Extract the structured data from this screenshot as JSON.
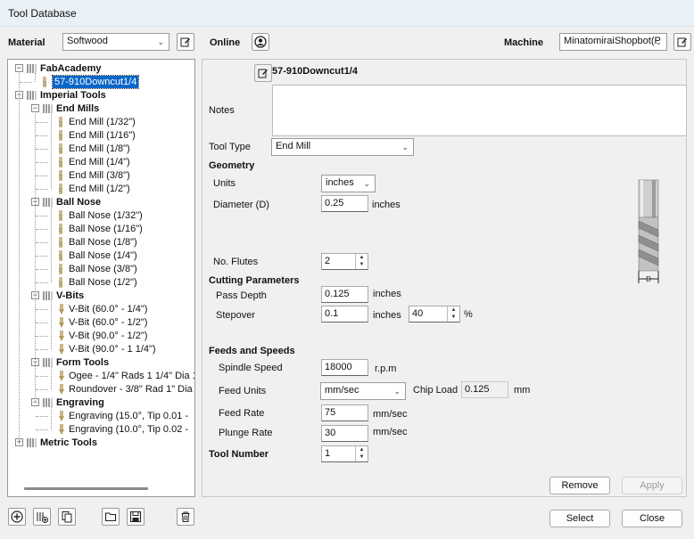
{
  "window": {
    "title": "Tool Database"
  },
  "top": {
    "material_label": "Material",
    "material_value": "Softwood",
    "online_label": "Online",
    "machine_label": "Machine",
    "machine_value": "MinatomiraiShopbot(P"
  },
  "tree": {
    "items": [
      {
        "label": "FabAcademy",
        "bold": true,
        "level": 0,
        "type": "group",
        "expander": "−"
      },
      {
        "label": "57-910Downcut1/4",
        "bold": false,
        "level": 1,
        "type": "tool",
        "selected": true
      },
      {
        "label": "Imperial Tools",
        "bold": true,
        "level": 0,
        "type": "group",
        "expander": "−"
      },
      {
        "label": "End Mills",
        "bold": true,
        "level": 1,
        "type": "group",
        "expander": "−"
      },
      {
        "label": "End Mill (1/32\")",
        "level": 2,
        "type": "tool"
      },
      {
        "label": "End Mill (1/16\")",
        "level": 2,
        "type": "tool"
      },
      {
        "label": "End Mill (1/8\")",
        "level": 2,
        "type": "tool"
      },
      {
        "label": "End Mill (1/4\")",
        "level": 2,
        "type": "tool"
      },
      {
        "label": "End Mill (3/8\")",
        "level": 2,
        "type": "tool"
      },
      {
        "label": "End Mill (1/2\")",
        "level": 2,
        "type": "tool"
      },
      {
        "label": "Ball Nose",
        "bold": true,
        "level": 1,
        "type": "group",
        "expander": "−"
      },
      {
        "label": "Ball Nose (1/32\")",
        "level": 2,
        "type": "tool"
      },
      {
        "label": "Ball Nose (1/16\")",
        "level": 2,
        "type": "tool"
      },
      {
        "label": "Ball Nose (1/8\")",
        "level": 2,
        "type": "tool"
      },
      {
        "label": "Ball Nose (1/4\")",
        "level": 2,
        "type": "tool"
      },
      {
        "label": "Ball Nose (3/8\")",
        "level": 2,
        "type": "tool"
      },
      {
        "label": "Ball Nose (1/2\")",
        "level": 2,
        "type": "tool"
      },
      {
        "label": "V-Bits",
        "bold": true,
        "level": 1,
        "type": "group",
        "expander": "−"
      },
      {
        "label": "V-Bit (60.0° - 1/4\")",
        "level": 2,
        "type": "vbit"
      },
      {
        "label": "V-Bit (60.0° - 1/2\")",
        "level": 2,
        "type": "vbit"
      },
      {
        "label": "V-Bit (90.0° - 1/2\")",
        "level": 2,
        "type": "vbit"
      },
      {
        "label": "V-Bit (90.0° - 1 1/4\")",
        "level": 2,
        "type": "vbit"
      },
      {
        "label": "Form Tools",
        "bold": true,
        "level": 1,
        "type": "group",
        "expander": "−"
      },
      {
        "label": "Ogee - 1/4\" Rads 1 1/4\" Dia 1",
        "level": 2,
        "type": "vbit"
      },
      {
        "label": "Roundover - 3/8\" Rad 1\" Dia :",
        "level": 2,
        "type": "vbit"
      },
      {
        "label": "Engraving",
        "bold": true,
        "level": 1,
        "type": "group",
        "expander": "−"
      },
      {
        "label": "Engraving (15.0°, Tip 0.01 -",
        "level": 2,
        "type": "vbit"
      },
      {
        "label": "Engraving (10.0°, Tip 0.02 -",
        "level": 2,
        "type": "vbit"
      },
      {
        "label": "Metric Tools",
        "bold": true,
        "level": 0,
        "type": "group",
        "expander": "+"
      }
    ]
  },
  "detail": {
    "tool_name": "57-910Downcut1/4",
    "notes_label": "Notes",
    "notes_value": "",
    "tool_type_label": "Tool Type",
    "tool_type_value": "End Mill",
    "geometry_heading": "Geometry",
    "units_label": "Units",
    "units_value": "inches",
    "diameter_label": "Diameter (D)",
    "diameter_value": "0.25",
    "diameter_unit": "inches",
    "flutes_label": "No. Flutes",
    "flutes_value": "2",
    "cutting_heading": "Cutting Parameters",
    "pass_depth_label": "Pass Depth",
    "pass_depth_value": "0.125",
    "pass_depth_unit": "inches",
    "stepover_label": "Stepover",
    "stepover_value": "0.1",
    "stepover_unit": "inches",
    "stepover_pct_value": "40",
    "stepover_pct_unit": "%",
    "feeds_heading": "Feeds and Speeds",
    "spindle_label": "Spindle Speed",
    "spindle_value": "18000",
    "spindle_unit": "r.p.m",
    "feed_units_label": "Feed Units",
    "feed_units_value": "mm/sec",
    "chip_load_label": "Chip Load",
    "chip_load_value": "0.125",
    "chip_load_unit": "mm",
    "feed_rate_label": "Feed Rate",
    "feed_rate_value": "75",
    "feed_rate_unit": "mm/sec",
    "plunge_rate_label": "Plunge Rate",
    "plunge_rate_value": "30",
    "plunge_rate_unit": "mm/sec",
    "tool_number_label": "Tool Number",
    "tool_number_value": "1",
    "diagram_label": "D"
  },
  "buttons": {
    "remove": "Remove",
    "apply": "Apply",
    "select": "Select",
    "close": "Close"
  },
  "toolbar_icons": [
    "add-icon",
    "add-group-icon",
    "copy-icon",
    "open-folder-icon",
    "save-icon",
    "delete-icon"
  ],
  "colors": {
    "selection": "#0a66c8",
    "titlebar": "#eaf1f6"
  }
}
